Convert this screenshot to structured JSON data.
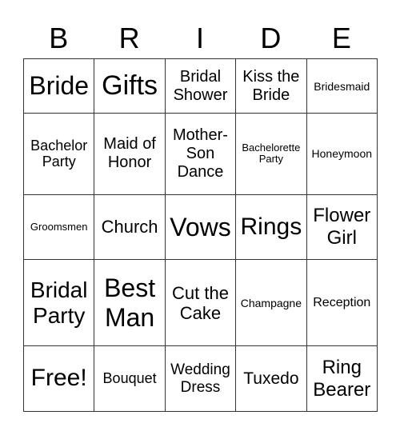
{
  "header": [
    "B",
    "R",
    "I",
    "D",
    "E"
  ],
  "rows": [
    [
      "Bride",
      "Gifts",
      "Bridal Shower",
      "Kiss the Bride",
      "Bridesmaid"
    ],
    [
      "Bachelor Party",
      "Maid of Honor",
      "Mother-Son Dance",
      "Bachelorette Party",
      "Honeymoon"
    ],
    [
      "Groomsmen",
      "Church",
      "Vows",
      "Rings",
      "Flower Girl"
    ],
    [
      "Bridal Party",
      "Best Man",
      "Cut the Cake",
      "Champagne",
      "Reception"
    ],
    [
      "Free!",
      "Bouquet",
      "Wedding Dress",
      "Tuxedo",
      "Ring Bearer"
    ]
  ]
}
